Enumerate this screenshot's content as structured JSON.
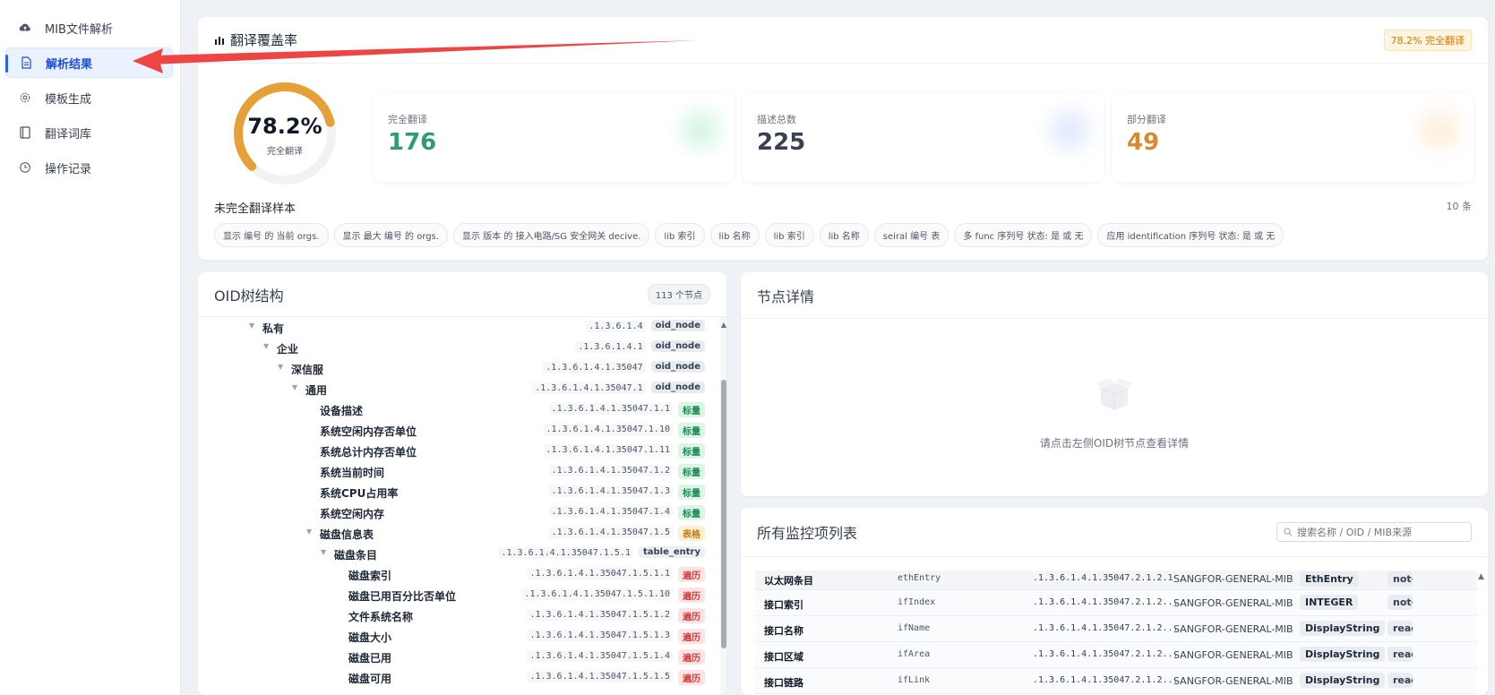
{
  "sidebar": {
    "items": [
      {
        "label": "MIB文件解析",
        "icon": "cloud-upload-icon",
        "active": false
      },
      {
        "label": "解析结果",
        "icon": "document-icon",
        "active": true
      },
      {
        "label": "模板生成",
        "icon": "gear-icon",
        "active": false
      },
      {
        "label": "翻译词库",
        "icon": "book-icon",
        "active": false
      },
      {
        "label": "操作记录",
        "icon": "clock-icon",
        "active": false
      }
    ]
  },
  "coverage": {
    "title": "翻译覆盖率",
    "badge": "78.2% 完全翻译",
    "gauge": {
      "value": "78.2%",
      "fraction": 0.782,
      "label": "完全翻译"
    },
    "stats": [
      {
        "label": "完全翻译",
        "value": "176",
        "color": "#2f9e6e"
      },
      {
        "label": "描述总数",
        "value": "225",
        "color": "#374151"
      },
      {
        "label": "部分翻译",
        "value": "49",
        "color": "#d9892b"
      }
    ],
    "samples_title": "未完全翻译样本",
    "samples_count": "10 条",
    "samples": [
      "显示 编号 的 当前 orgs.",
      "显示 最大 编号 的 orgs.",
      "显示 版本 的 接入电路/SG 安全网关 decive.",
      "lib 索引",
      "lib 名称",
      "lib 索引",
      "lib 名称",
      "seiral 编号 表",
      "多 func 序列号 状态: 是 或 无",
      "应用 identification 序列号 状态: 是 或 无"
    ]
  },
  "oid_tree": {
    "title": "OID树结构",
    "node_count": "113 个节点",
    "rows": [
      {
        "name": "私有",
        "oid": ".1.3.6.1.4",
        "tag": "oid_node",
        "kind": "node",
        "level": 0,
        "expanded": true
      },
      {
        "name": "企业",
        "oid": ".1.3.6.1.4.1",
        "tag": "oid_node",
        "kind": "node",
        "level": 1,
        "expanded": true
      },
      {
        "name": "深信服",
        "oid": ".1.3.6.1.4.1.35047",
        "tag": "oid_node",
        "kind": "node",
        "level": 2,
        "expanded": true
      },
      {
        "name": "通用",
        "oid": ".1.3.6.1.4.1.35047.1",
        "tag": "oid_node",
        "kind": "node",
        "level": 3,
        "expanded": true
      },
      {
        "name": "设备描述",
        "oid": ".1.3.6.1.4.1.35047.1.1",
        "tag": "标量",
        "kind": "scalar",
        "level": 4,
        "expanded": false
      },
      {
        "name": "系统空闲内存否单位",
        "oid": ".1.3.6.1.4.1.35047.1.10",
        "tag": "标量",
        "kind": "scalar",
        "level": 4,
        "expanded": false
      },
      {
        "name": "系统总计内存否单位",
        "oid": ".1.3.6.1.4.1.35047.1.11",
        "tag": "标量",
        "kind": "scalar",
        "level": 4,
        "expanded": false
      },
      {
        "name": "系统当前时间",
        "oid": ".1.3.6.1.4.1.35047.1.2",
        "tag": "标量",
        "kind": "scalar",
        "level": 4,
        "expanded": false
      },
      {
        "name": "系统CPU占用率",
        "oid": ".1.3.6.1.4.1.35047.1.3",
        "tag": "标量",
        "kind": "scalar",
        "level": 4,
        "expanded": false
      },
      {
        "name": "系统空闲内存",
        "oid": ".1.3.6.1.4.1.35047.1.4",
        "tag": "标量",
        "kind": "scalar",
        "level": 4,
        "expanded": false
      },
      {
        "name": "磁盘信息表",
        "oid": ".1.3.6.1.4.1.35047.1.5",
        "tag": "表格",
        "kind": "table",
        "level": 4,
        "expanded": true
      },
      {
        "name": "磁盘条目",
        "oid": ".1.3.6.1.4.1.35047.1.5.1",
        "tag": "table_entry",
        "kind": "entry",
        "level": 5,
        "expanded": true
      },
      {
        "name": "磁盘索引",
        "oid": ".1.3.6.1.4.1.35047.1.5.1.1",
        "tag": "遍历",
        "kind": "col",
        "level": 6,
        "expanded": false
      },
      {
        "name": "磁盘已用百分比否单位",
        "oid": ".1.3.6.1.4.1.35047.1.5.1.10",
        "tag": "遍历",
        "kind": "col",
        "level": 6,
        "expanded": false
      },
      {
        "name": "文件系统名称",
        "oid": ".1.3.6.1.4.1.35047.1.5.1.2",
        "tag": "遍历",
        "kind": "col",
        "level": 6,
        "expanded": false
      },
      {
        "name": "磁盘大小",
        "oid": ".1.3.6.1.4.1.35047.1.5.1.3",
        "tag": "遍历",
        "kind": "col",
        "level": 6,
        "expanded": false
      },
      {
        "name": "磁盘已用",
        "oid": ".1.3.6.1.4.1.35047.1.5.1.4",
        "tag": "遍历",
        "kind": "col",
        "level": 6,
        "expanded": false
      },
      {
        "name": "磁盘可用",
        "oid": ".1.3.6.1.4.1.35047.1.5.1.5",
        "tag": "遍历",
        "kind": "col",
        "level": 6,
        "expanded": false
      }
    ]
  },
  "detail": {
    "title": "节点详情",
    "empty_text": "请点击左侧OID树节点查看详情"
  },
  "monitor": {
    "title": "所有监控项列表",
    "search_placeholder": "搜索名称 / OID / MIB来源",
    "rows": [
      {
        "name": "以太网条目",
        "symbol": "ethEntry",
        "oid": ".1.3.6.1.4.1.35047.2.1.2.1",
        "mib": "SANGFOR-GENERAL-MIB",
        "type": "EthEntry",
        "access": "not-accessible"
      },
      {
        "name": "接口索引",
        "symbol": "ifIndex",
        "oid": ".1.3.6.1.4.1.35047.2.1.2...",
        "mib": "SANGFOR-GENERAL-MIB",
        "type": "INTEGER",
        "access": "not-accessible"
      },
      {
        "name": "接口名称",
        "symbol": "ifName",
        "oid": ".1.3.6.1.4.1.35047.2.1.2...",
        "mib": "SANGFOR-GENERAL-MIB",
        "type": "DisplayString",
        "access": "read-only"
      },
      {
        "name": "接口区域",
        "symbol": "ifArea",
        "oid": ".1.3.6.1.4.1.35047.2.1.2...",
        "mib": "SANGFOR-GENERAL-MIB",
        "type": "DisplayString",
        "access": "read-only"
      },
      {
        "name": "接口链路",
        "symbol": "ifLink",
        "oid": ".1.3.6.1.4.1.35047.2.1.2...",
        "mib": "SANGFOR-GENERAL-MIB",
        "type": "DisplayString",
        "access": "read-only"
      }
    ]
  },
  "colors": {
    "accent": "#2563eb",
    "gauge": "#e5a038",
    "arrow": "#ef4444"
  }
}
